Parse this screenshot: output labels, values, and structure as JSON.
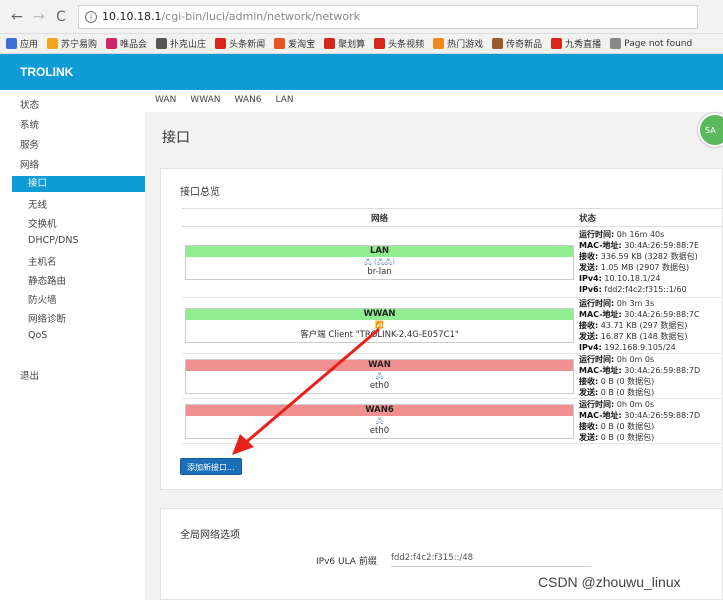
{
  "browser": {
    "url_host": "10.10.18.1",
    "url_path": "/cgi-bin/luci/admin/network/network",
    "bookmarks": [
      {
        "label": "应用",
        "color": "#3b6fd6"
      },
      {
        "label": "苏宁易购",
        "color": "#f2a51a"
      },
      {
        "label": "唯品会",
        "color": "#d0246b"
      },
      {
        "label": "扑克山庄",
        "color": "#555555"
      },
      {
        "label": "头条新闻",
        "color": "#d8261b"
      },
      {
        "label": "爱淘宝",
        "color": "#e8531f"
      },
      {
        "label": "聚划算",
        "color": "#d8261b"
      },
      {
        "label": "头条视频",
        "color": "#d8261b"
      },
      {
        "label": "热门游戏",
        "color": "#f08a1c"
      },
      {
        "label": "传奇新品",
        "color": "#9a5a2a"
      },
      {
        "label": "九秀直播",
        "color": "#d8261b"
      },
      {
        "label": "Page not found",
        "color": "#888888"
      }
    ]
  },
  "header": {
    "brand": "TROLINK"
  },
  "sidebar": {
    "items": [
      {
        "label": "状态"
      },
      {
        "label": "系统"
      },
      {
        "label": "服务"
      },
      {
        "label": "网络"
      },
      {
        "label": "接口"
      },
      {
        "label": "无线"
      },
      {
        "label": "交换机"
      },
      {
        "label": "DHCP/DNS"
      },
      {
        "label": "主机名"
      },
      {
        "label": "静态路由"
      },
      {
        "label": "防火墙"
      },
      {
        "label": "网络诊断"
      },
      {
        "label": "QoS"
      },
      {
        "label": "退出"
      }
    ]
  },
  "tabs": [
    "WAN",
    "WWAN",
    "WAN6",
    "LAN"
  ],
  "page": {
    "title": "接口",
    "save_badge": "SA"
  },
  "overview": {
    "title": "接口总览",
    "col_network": "网络",
    "col_status": "状态",
    "interfaces": [
      {
        "name": "LAN",
        "icons": "🖧 (🖧🖧)",
        "device": "br-lan",
        "color": "green",
        "status": [
          {
            "k": "运行时间:",
            "v": " 0h 16m 40s"
          },
          {
            "k": "MAC-地址:",
            "v": " 30:4A:26:59:88:7E"
          },
          {
            "k": "接收:",
            "v": " 336.59 KB (3282 数据包)"
          },
          {
            "k": "发送:",
            "v": " 1.05 MB (2907 数据包)"
          },
          {
            "k": "IPv4:",
            "v": " 10.10.18.1/24"
          },
          {
            "k": "IPv6:",
            "v": " fdd2:f4c2:f315::1/60"
          }
        ]
      },
      {
        "name": "WWAN",
        "icons": "📶",
        "device": "客户端 Client \"TROLINK-2.4G-E057C1\"",
        "color": "green",
        "status": [
          {
            "k": "运行时间:",
            "v": " 0h 3m 3s"
          },
          {
            "k": "MAC-地址:",
            "v": " 30:4A:26:59:88:7C"
          },
          {
            "k": "接收:",
            "v": " 43.71 KB (297 数据包)"
          },
          {
            "k": "发送:",
            "v": " 16.87 KB (148 数据包)"
          },
          {
            "k": "IPv4:",
            "v": " 192.168.9.105/24"
          }
        ]
      },
      {
        "name": "WAN",
        "icons": "🖧",
        "device": "eth0",
        "color": "red",
        "status": [
          {
            "k": "运行时间:",
            "v": " 0h 0m 0s"
          },
          {
            "k": "MAC-地址:",
            "v": " 30:4A:26:59:88:7D"
          },
          {
            "k": "接收:",
            "v": " 0 B (0 数据包)"
          },
          {
            "k": "发送:",
            "v": " 0 B (0 数据包)"
          }
        ]
      },
      {
        "name": "WAN6",
        "icons": "🖧",
        "device": "eth0",
        "color": "red",
        "status": [
          {
            "k": "运行时间:",
            "v": " 0h 0m 0s"
          },
          {
            "k": "MAC-地址:",
            "v": " 30:4A:26:59:88:7D"
          },
          {
            "k": "接收:",
            "v": " 0 B (0 数据包)"
          },
          {
            "k": "发送:",
            "v": " 0 B (0 数据包)"
          }
        ]
      }
    ],
    "add_button": "添加新接口..."
  },
  "global": {
    "title": "全局网络选项",
    "ula_label": "IPv6 ULA 前缀",
    "ula_value": "fdd2:f4c2:f315::/48"
  },
  "watermark": "CSDN @zhouwu_linux"
}
